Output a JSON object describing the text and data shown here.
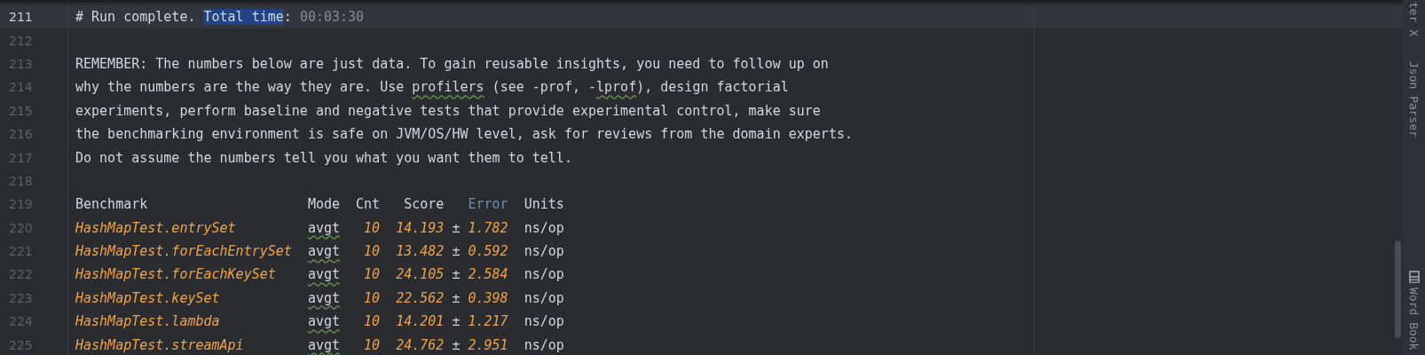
{
  "editor": {
    "lines": [
      {
        "number": "211",
        "current": true,
        "kind": "text",
        "segments": [
          {
            "text": "# Run complete. ",
            "kind": "plain"
          },
          {
            "text": "Total time",
            "kind": "selected"
          },
          {
            "text": ": ",
            "kind": "plain"
          },
          {
            "text": "00:03:30",
            "kind": "dim"
          }
        ]
      },
      {
        "number": "212",
        "current": false,
        "kind": "blank"
      },
      {
        "number": "213",
        "current": false,
        "kind": "text",
        "segments": [
          {
            "text": "REMEMBER: The numbers below are just data. To gain reusable insights, you need to follow up on",
            "kind": "plain"
          }
        ]
      },
      {
        "number": "214",
        "current": false,
        "kind": "text",
        "segments": [
          {
            "text": "why the numbers are the way they are. Use ",
            "kind": "plain"
          },
          {
            "text": "profilers",
            "kind": "typo"
          },
          {
            "text": " (see -prof, -",
            "kind": "plain"
          },
          {
            "text": "lprof",
            "kind": "typo"
          },
          {
            "text": "), design factorial",
            "kind": "plain"
          }
        ]
      },
      {
        "number": "215",
        "current": false,
        "kind": "text",
        "segments": [
          {
            "text": "experiments, perform baseline and negative tests that provide experimental control, make sure",
            "kind": "plain"
          }
        ]
      },
      {
        "number": "216",
        "current": false,
        "kind": "text",
        "segments": [
          {
            "text": "the benchmarking environment is safe on JVM/OS/HW level, ask for reviews from the domain experts.",
            "kind": "plain"
          }
        ]
      },
      {
        "number": "217",
        "current": false,
        "kind": "text",
        "segments": [
          {
            "text": "Do not assume the numbers tell you what you want them to tell.",
            "kind": "plain"
          }
        ]
      },
      {
        "number": "218",
        "current": false,
        "kind": "blank"
      },
      {
        "number": "219",
        "current": false,
        "kind": "table-header",
        "columns": [
          "Benchmark",
          "Mode",
          "Cnt",
          "Score",
          "Error",
          "Units"
        ]
      },
      {
        "number": "220",
        "current": false,
        "kind": "table-row",
        "benchmark": "HashMapTest.entrySet",
        "mode": "avgt",
        "mode_flagged": true,
        "cnt": "10",
        "score": "14.193",
        "pm": "±",
        "error": "1.782",
        "units": "ns/op"
      },
      {
        "number": "221",
        "current": false,
        "kind": "table-row",
        "benchmark": "HashMapTest.forEachEntrySet",
        "mode": "avgt",
        "mode_flagged": true,
        "cnt": "10",
        "score": "13.482",
        "pm": "±",
        "error": "0.592",
        "units": "ns/op"
      },
      {
        "number": "222",
        "current": false,
        "kind": "table-row",
        "benchmark": "HashMapTest.forEachKeySet",
        "mode": "avgt",
        "mode_flagged": true,
        "cnt": "10",
        "score": "24.105",
        "pm": "±",
        "error": "2.584",
        "units": "ns/op"
      },
      {
        "number": "223",
        "current": false,
        "kind": "table-row",
        "benchmark": "HashMapTest.keySet",
        "mode": "avgt",
        "mode_flagged": true,
        "cnt": "10",
        "score": "22.562",
        "pm": "±",
        "error": "0.398",
        "units": "ns/op"
      },
      {
        "number": "224",
        "current": false,
        "kind": "table-row",
        "benchmark": "HashMapTest.lambda",
        "mode": "avgt",
        "mode_flagged": true,
        "cnt": "10",
        "score": "14.201",
        "pm": "±",
        "error": "1.217",
        "units": "ns/op"
      },
      {
        "number": "225",
        "current": false,
        "kind": "table-row",
        "benchmark": "HashMapTest.streamApi",
        "mode": "avgt",
        "mode_flagged": true,
        "cnt": "10",
        "score": "24.762",
        "pm": "±",
        "error": "2.951",
        "units": "ns/op"
      }
    ]
  },
  "tool_strip": {
    "items": [
      {
        "label": "ter X",
        "kind": "cut"
      },
      {
        "label": "Json Parser",
        "kind": "plain"
      },
      {
        "label": "Word Book",
        "kind": "book"
      }
    ]
  }
}
